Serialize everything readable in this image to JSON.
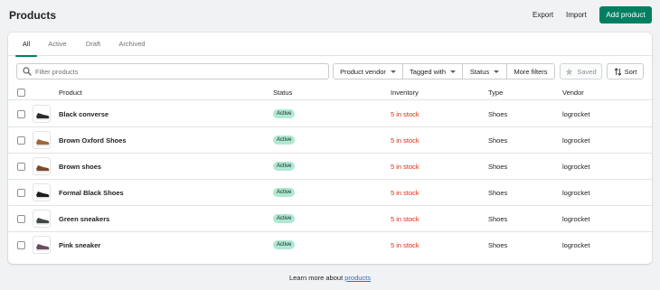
{
  "header": {
    "title": "Products",
    "export_label": "Export",
    "import_label": "Import",
    "add_label": "Add product",
    "accent_color": "#008060"
  },
  "tabs": [
    {
      "label": "All",
      "active": true
    },
    {
      "label": "Active",
      "active": false
    },
    {
      "label": "Draft",
      "active": false
    },
    {
      "label": "Archived",
      "active": false
    }
  ],
  "filters": {
    "search_placeholder": "Filter products",
    "search_value": "",
    "vendor_label": "Product vendor",
    "tagged_label": "Tagged with",
    "status_label": "Status",
    "more_label": "More filters",
    "saved_label": "Saved",
    "sort_label": "Sort"
  },
  "table": {
    "columns": [
      "Product",
      "Status",
      "Inventory",
      "Type",
      "Vendor"
    ],
    "rows": [
      {
        "name": "Black converse",
        "status": "Active",
        "inventory": "5 in stock",
        "type": "Shoes",
        "vendor": "logrocket",
        "thumb_color": "#2b2b2b"
      },
      {
        "name": "Brown Oxford Shoes",
        "status": "Active",
        "inventory": "5 in stock",
        "type": "Shoes",
        "vendor": "logrocket",
        "thumb_color": "#a0673a"
      },
      {
        "name": "Brown shoes",
        "status": "Active",
        "inventory": "5 in stock",
        "type": "Shoes",
        "vendor": "logrocket",
        "thumb_color": "#7a4a2a"
      },
      {
        "name": "Formal Black Shoes",
        "status": "Active",
        "inventory": "5 in stock",
        "type": "Shoes",
        "vendor": "logrocket",
        "thumb_color": "#1e1e1e"
      },
      {
        "name": "Green sneakers",
        "status": "Active",
        "inventory": "5 in stock",
        "type": "Shoes",
        "vendor": "logrocket",
        "thumb_color": "#3f4a44"
      },
      {
        "name": "Pink sneaker",
        "status": "Active",
        "inventory": "5 in stock",
        "type": "Shoes",
        "vendor": "logrocket",
        "thumb_color": "#6b4a5e"
      }
    ]
  },
  "footer": {
    "text": "Learn more about ",
    "link_label": "products"
  },
  "colors": {
    "badge_bg": "#aee9d1",
    "inventory_red": "#d72c0d",
    "link_blue": "#2c6ecb"
  },
  "icons": {
    "search": "search-icon",
    "star": "star-icon",
    "sort": "sort-arrows-icon",
    "caret": "caret-down-icon"
  }
}
